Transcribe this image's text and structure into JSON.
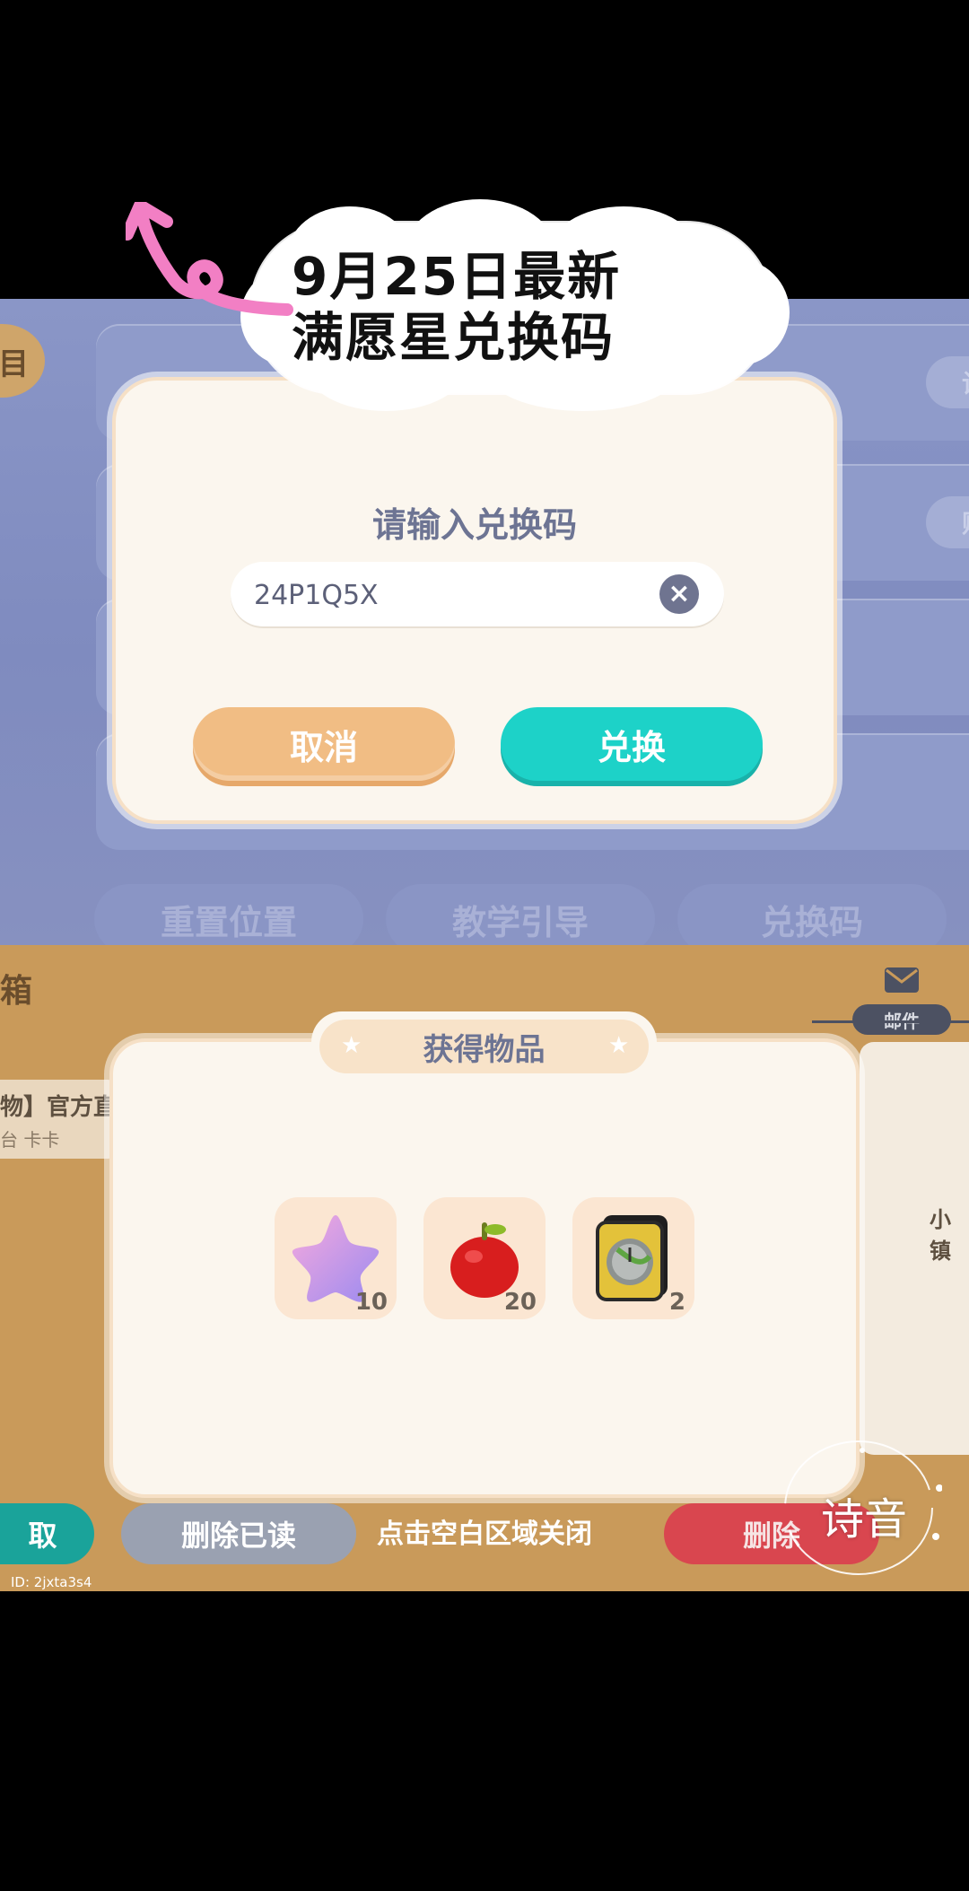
{
  "caption": {
    "line1": "9月25日最新",
    "line2": "满愿星兑换码"
  },
  "settings_screen": {
    "left_badge": "目",
    "row_pills": [
      "设",
      "贴"
    ],
    "bottom_buttons": {
      "reset_position": "重置位置",
      "tutorial": "教学引导",
      "redeem_code": "兑换码"
    }
  },
  "redeem_dialog": {
    "title": "请输入兑换码",
    "code_value": "24P1Q5X",
    "cancel_label": "取消",
    "exchange_label": "兑换"
  },
  "mail_screen": {
    "left_header": "箱",
    "mail_tab_label": "邮件",
    "list_item": {
      "title": "物】官方直",
      "subtitle": "台 卡卡"
    },
    "right_snippet": "小镇",
    "claim_label": "取",
    "delete_read_label": "删除已读",
    "delete_label": "删除",
    "close_hint": "点击空白区域关闭",
    "id_text": "ID: 2jxta3s4"
  },
  "reward_dialog": {
    "title": "获得物品",
    "items": [
      {
        "icon": "star-icon",
        "count": "10"
      },
      {
        "icon": "apple-icon",
        "count": "20"
      },
      {
        "icon": "time-book-icon",
        "count": "2"
      }
    ]
  },
  "watermark": {
    "text": "诗音"
  },
  "colors": {
    "cancel": "#f1bd84",
    "exchange": "#1dd2c8",
    "panel": "#fbf6ee",
    "bg_top": "#8a96c7",
    "bg_bottom": "#c99a5a"
  }
}
